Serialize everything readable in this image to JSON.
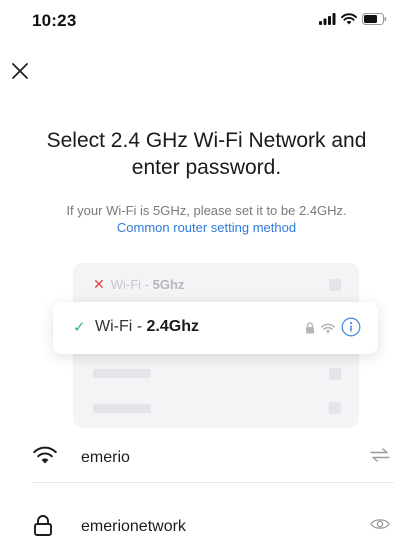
{
  "status_bar": {
    "time": "10:23"
  },
  "header": {
    "title": "Select 2.4 GHz Wi-Fi Network and enter password.",
    "subtitle": "If your Wi-Fi is 5GHz, please set it to be 2.4GHz.",
    "router_link": "Common router setting method"
  },
  "illustration": {
    "bad_prefix": "Wi-Fi - ",
    "bad_band": "5Ghz",
    "good_prefix": "Wi-Fi - ",
    "good_band": "2.4Ghz"
  },
  "form": {
    "network_name": "emerio",
    "password": "emerionetwork"
  },
  "colors": {
    "accent": "#2f7bd8",
    "check_green": "#3ab56e",
    "error_red": "#e2453c"
  },
  "icons": [
    "signal-icon",
    "wifi-icon",
    "battery-icon",
    "close-icon",
    "lock-icon",
    "info-icon",
    "switch-network-icon",
    "eye-icon"
  ]
}
